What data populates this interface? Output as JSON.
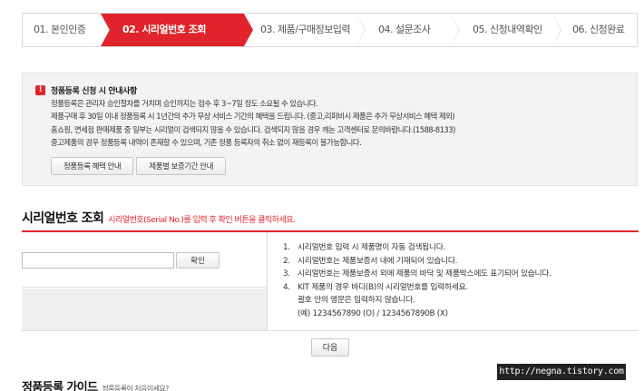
{
  "steps": [
    {
      "label": "01. 본인인증",
      "active": false
    },
    {
      "label": "02. 시리얼번호 조회",
      "active": true
    },
    {
      "label": "03. 제품/구매정보입력",
      "active": false
    },
    {
      "label": "04. 설문조사",
      "active": false
    },
    {
      "label": "05. 신청내역확인",
      "active": false
    },
    {
      "label": "06. 신청완료",
      "active": false
    }
  ],
  "notice": {
    "icon": "warning-icon",
    "icon_glyph": "!",
    "title": "정품등록 신청 시 안내사항",
    "lines": [
      "정품등록은 관리자 승인절차를 거치며 승인까지는 접수 후 3~7일 정도 소요될 수 있습니다.",
      "제품구매 후 30일 이내 정품등록 시 1년간의 추가 무상 서비스 기간의 혜택을 드립니다. (중고,리퍼비시 제품은 추가 무상서비스 혜택 제외)",
      "홈쇼핑, 면세점 판매제품 중 일부는 시리얼이 검색되지 않을 수 있습니다. 검색되지 않을 경우 캐논 고객센터로 문의바랍니다.(1588-8133)",
      "중고제품의 경우 정품등록 내역이 존재할 수 있으며, 기존 정품 등록자의 취소 없이 재등록이 불가능합니다."
    ],
    "buttons": {
      "benefit": "정품등록 혜택 안내",
      "warranty": "제품별 보증기간 안내"
    }
  },
  "serial": {
    "title": "시리얼번호 조회",
    "subtitle": "시리얼번호(Serial No.)를 입력 후 확인 버튼을 클릭하세요.",
    "input_value": "",
    "confirm_label": "확인",
    "hints": [
      {
        "num": "1.",
        "text": "시리얼번호 입력 시 제품명이 자동 검색됩니다."
      },
      {
        "num": "2.",
        "text": "시리얼번호는 제품보증서 내에 기재되어 있습니다."
      },
      {
        "num": "3.",
        "text": "시리얼번호는 제품보증서 외에 제품의 바닥 및 제품박스에도 표기되어 있습니다."
      },
      {
        "num": "4.",
        "text": "KIT 제품의 경우 바디(B)의 시리얼번호를 입력하세요."
      }
    ],
    "hint_notes": [
      "괄호 안의 영문은 입력하지 않습니다.",
      "(예) 1234567890 (O) / 1234567890B (X)"
    ],
    "next_label": "다음"
  },
  "guide": {
    "title": "정품등록 가이드",
    "subtitle": "정품등록이 처음이세요?"
  },
  "watermark": "http://negna.tistory.com",
  "colors": {
    "accent": "#e1242b",
    "notice_bg": "#f3f3f3"
  }
}
